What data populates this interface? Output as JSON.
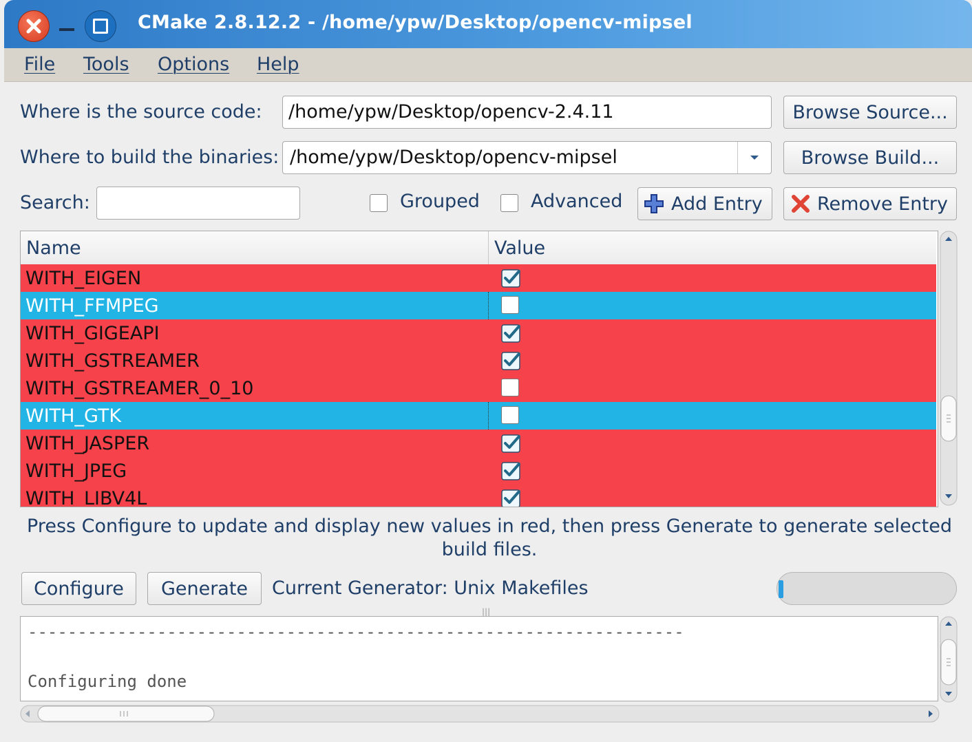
{
  "window": {
    "title": "CMake 2.8.12.2 - /home/ypw/Desktop/opencv-mipsel"
  },
  "menu": {
    "file": "File",
    "tools": "Tools",
    "options": "Options",
    "help": "Help"
  },
  "source": {
    "label": "Where is the source code:",
    "value": "/home/ypw/Desktop/opencv-2.4.11",
    "browse": "Browse Source..."
  },
  "build": {
    "label": "Where to build the binaries:",
    "value": "/home/ypw/Desktop/opencv-mipsel",
    "browse": "Browse Build..."
  },
  "search": {
    "label": "Search:",
    "value": ""
  },
  "options": {
    "grouped": "Grouped",
    "advanced": "Advanced",
    "add_entry": "Add Entry",
    "remove_entry": "Remove Entry"
  },
  "table": {
    "col_name": "Name",
    "col_value": "Value",
    "rows": [
      {
        "name": "WITH_EIGEN",
        "checked": true,
        "selected": false
      },
      {
        "name": "WITH_FFMPEG",
        "checked": false,
        "selected": true
      },
      {
        "name": "WITH_GIGEAPI",
        "checked": true,
        "selected": false
      },
      {
        "name": "WITH_GSTREAMER",
        "checked": true,
        "selected": false
      },
      {
        "name": "WITH_GSTREAMER_0_10",
        "checked": false,
        "selected": false
      },
      {
        "name": "WITH_GTK",
        "checked": false,
        "selected": true
      },
      {
        "name": "WITH_JASPER",
        "checked": true,
        "selected": false
      },
      {
        "name": "WITH_JPEG",
        "checked": true,
        "selected": false
      },
      {
        "name": "WITH_LIBV4L",
        "checked": true,
        "selected": false
      }
    ]
  },
  "info": "Press Configure to update and display new values in red, then press Generate to generate selected build files.",
  "actions": {
    "configure": "Configure",
    "generate": "Generate",
    "generator": "Current Generator: Unix Makefiles"
  },
  "progress": 0.02,
  "output": {
    "lines": [
      "------------------------------------------------------------------",
      "",
      "Configuring done"
    ]
  },
  "colors": {
    "changed_row": "#f6434b",
    "selected_row": "#22b4e4",
    "title_bar": "#3d8ad6"
  }
}
